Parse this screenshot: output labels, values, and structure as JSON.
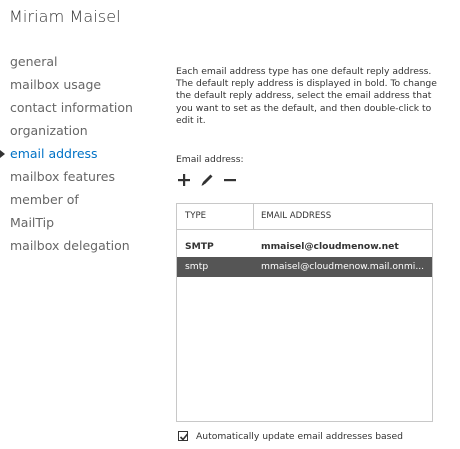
{
  "header": {
    "title": "Miriam Maisel"
  },
  "nav": {
    "items": [
      {
        "label": "general",
        "active": false
      },
      {
        "label": "mailbox usage",
        "active": false
      },
      {
        "label": "contact information",
        "active": false
      },
      {
        "label": "organization",
        "active": false
      },
      {
        "label": "email address",
        "active": true
      },
      {
        "label": "mailbox features",
        "active": false
      },
      {
        "label": "member of",
        "active": false
      },
      {
        "label": "MailTip",
        "active": false
      },
      {
        "label": "mailbox delegation",
        "active": false
      }
    ]
  },
  "main": {
    "description": "Each email address type has one default reply address. The default reply address is displayed in bold. To change the default reply address, select the email address that you want to set as the default, and then double-click to edit it.",
    "field_label": "Email address:",
    "toolbar": {
      "icons": [
        "add-icon",
        "edit-icon",
        "remove-icon"
      ]
    },
    "grid": {
      "columns": [
        "TYPE",
        "EMAIL ADDRESS"
      ],
      "rows": [
        {
          "type": "SMTP",
          "address": "mmaisel@cloudmenow.net",
          "bold": true,
          "selected": false
        },
        {
          "type": "smtp",
          "address": "mmaisel@cloudmenow.mail.onmi...",
          "bold": false,
          "selected": true
        }
      ]
    },
    "auto_update": {
      "checked": true,
      "label": "Automatically update email addresses based"
    }
  },
  "colors": {
    "accent": "#0072c6",
    "selected_row": "#555555",
    "border": "#c8c8c8"
  }
}
